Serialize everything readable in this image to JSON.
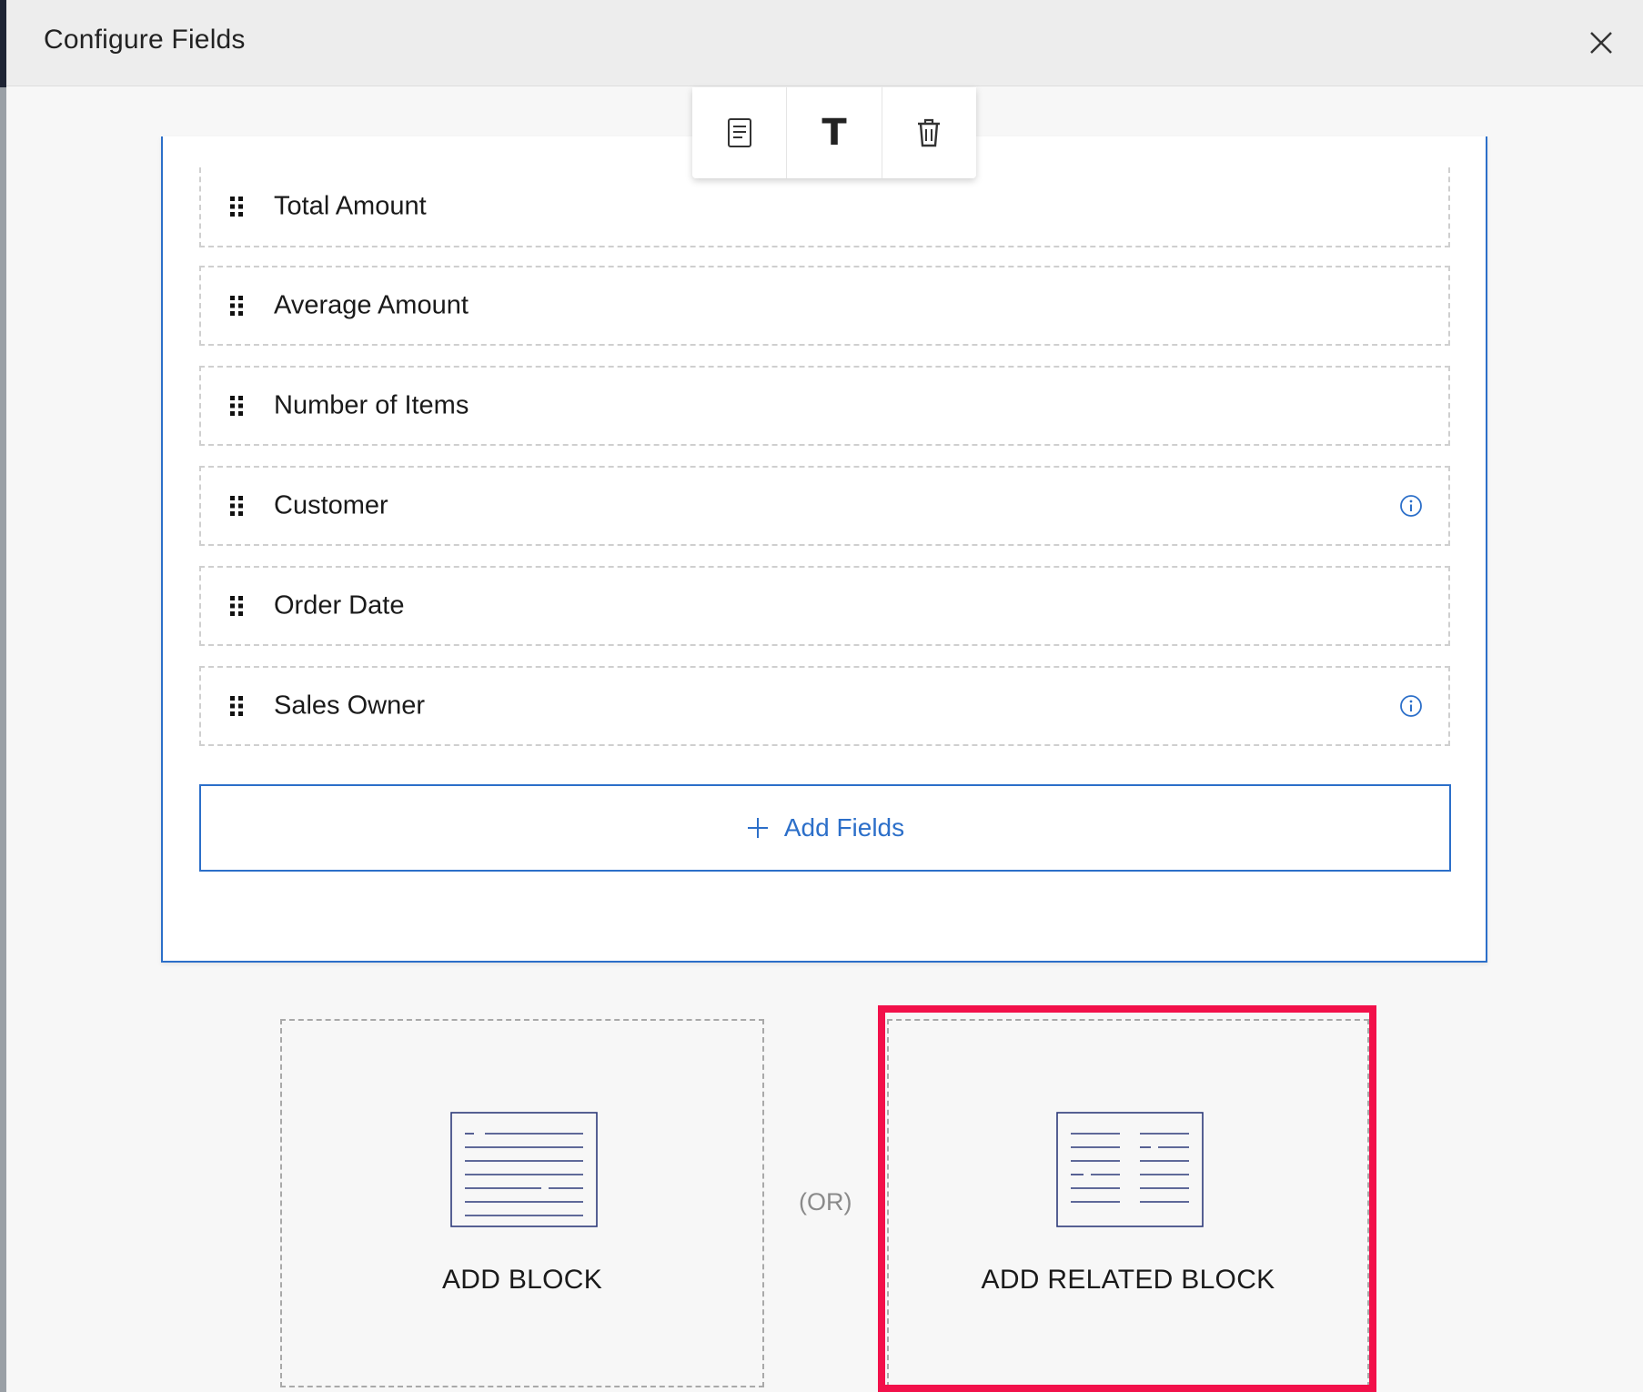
{
  "dialog": {
    "title": "Configure Fields"
  },
  "toolbar": {
    "tools": [
      {
        "icon": "document-icon"
      },
      {
        "icon": "text-format-icon",
        "glyph": "T"
      },
      {
        "icon": "trash-icon"
      }
    ]
  },
  "fields": [
    {
      "label": "Total Amount",
      "info": false
    },
    {
      "label": "Average Amount",
      "info": false
    },
    {
      "label": "Number of Items",
      "info": false
    },
    {
      "label": "Customer",
      "info": true
    },
    {
      "label": "Order Date",
      "info": false
    },
    {
      "label": "Sales Owner",
      "info": true
    }
  ],
  "add_fields": {
    "label": "Add Fields"
  },
  "options": {
    "add_block": "ADD BLOCK",
    "separator": "(OR)",
    "add_related_block": "ADD RELATED BLOCK"
  },
  "colors": {
    "accent": "#2c6fc9",
    "highlight": "#f2104a",
    "header_bg": "#ededed"
  }
}
